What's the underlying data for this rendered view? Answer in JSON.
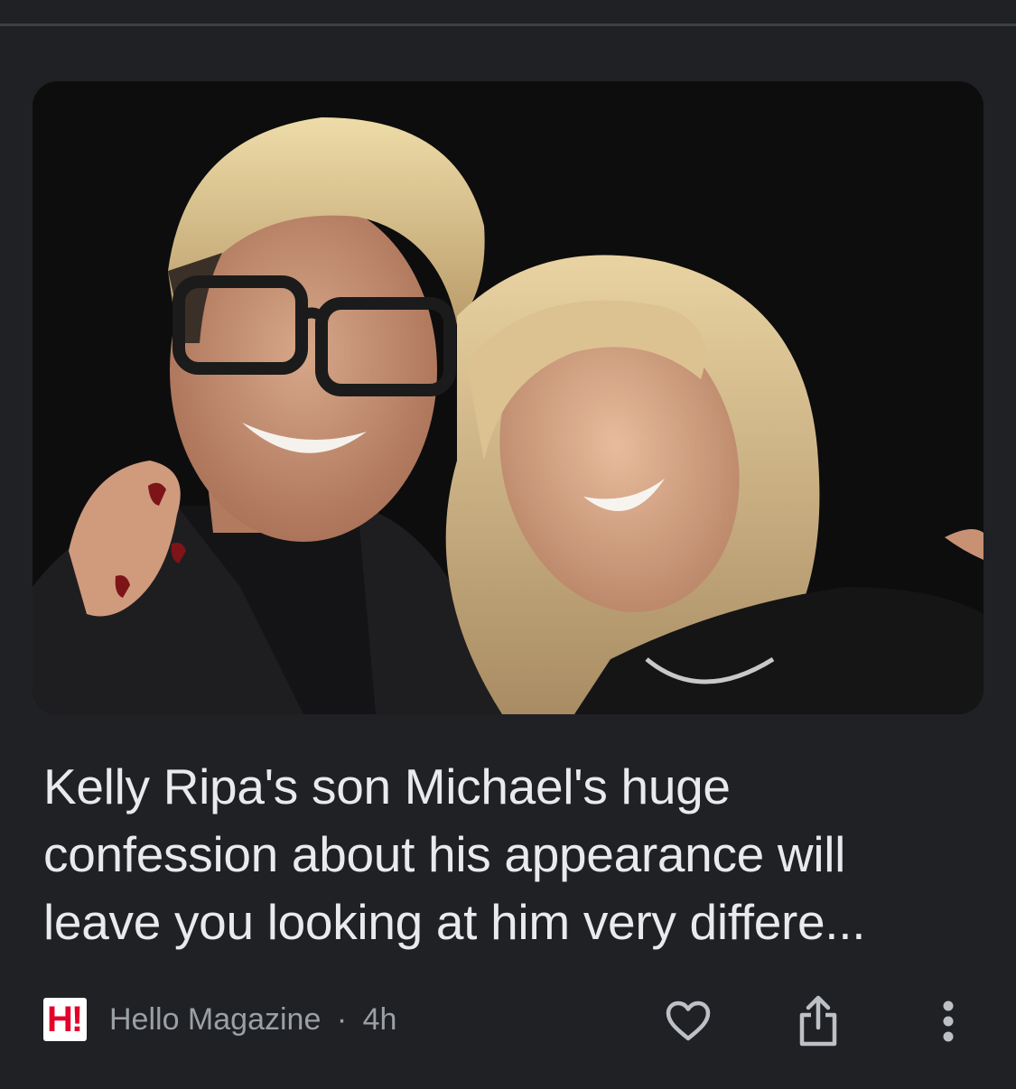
{
  "article": {
    "image_alt": "Photo of Kelly Ripa with her son Michael",
    "headline": "Kelly Ripa's son Michael's huge confession about his appearance will leave you looking at him very differe...",
    "publisher": {
      "name": "Hello Magazine",
      "logo_text": "H!",
      "logo_color": "#e4002b"
    },
    "separator": "·",
    "age": "4h"
  },
  "actions": {
    "like_icon": "heart-icon",
    "share_icon": "share-icon",
    "more_icon": "more-vert-icon"
  },
  "colors": {
    "background": "#202124",
    "headline_text": "#e8eaed",
    "meta_text": "#9aa0a6",
    "icon": "#bdc1c6"
  }
}
